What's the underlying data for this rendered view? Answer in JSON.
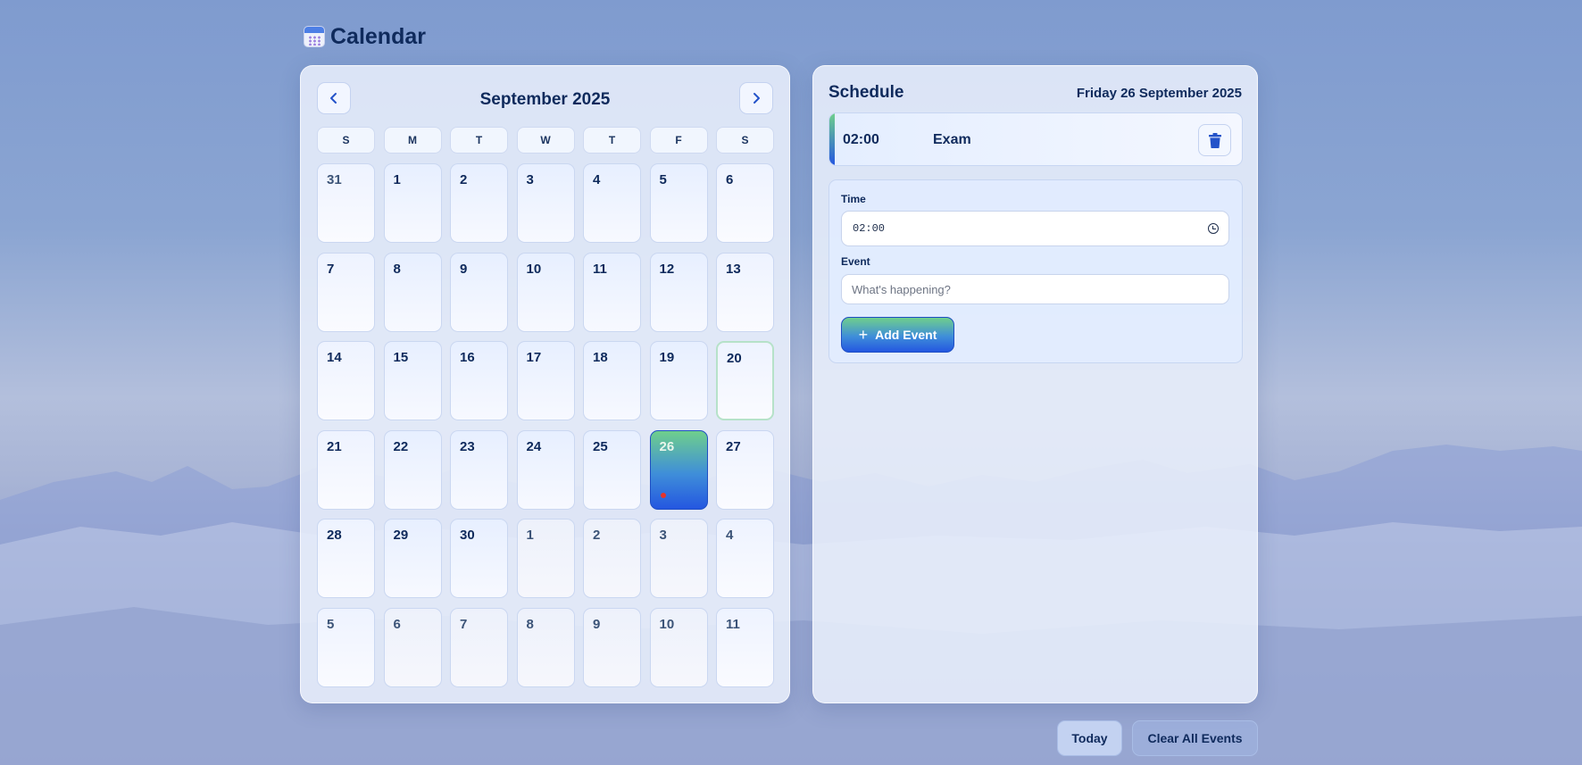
{
  "app": {
    "title": "Calendar",
    "icon": "calendar-icon"
  },
  "calendar": {
    "month_label": "September 2025",
    "prev_icon": "chevron-left-icon",
    "next_icon": "chevron-right-icon",
    "weekdays": [
      "S",
      "M",
      "T",
      "W",
      "T",
      "F",
      "S"
    ],
    "days": [
      {
        "label": "31",
        "current": false
      },
      {
        "label": "1",
        "current": true
      },
      {
        "label": "2",
        "current": true
      },
      {
        "label": "3",
        "current": true
      },
      {
        "label": "4",
        "current": true
      },
      {
        "label": "5",
        "current": true
      },
      {
        "label": "6",
        "current": true
      },
      {
        "label": "7",
        "current": true
      },
      {
        "label": "8",
        "current": true
      },
      {
        "label": "9",
        "current": true
      },
      {
        "label": "10",
        "current": true
      },
      {
        "label": "11",
        "current": true
      },
      {
        "label": "12",
        "current": true
      },
      {
        "label": "13",
        "current": true
      },
      {
        "label": "14",
        "current": true
      },
      {
        "label": "15",
        "current": true
      },
      {
        "label": "16",
        "current": true
      },
      {
        "label": "17",
        "current": true
      },
      {
        "label": "18",
        "current": true
      },
      {
        "label": "19",
        "current": true
      },
      {
        "label": "20",
        "current": true,
        "today": true
      },
      {
        "label": "21",
        "current": true
      },
      {
        "label": "22",
        "current": true
      },
      {
        "label": "23",
        "current": true
      },
      {
        "label": "24",
        "current": true
      },
      {
        "label": "25",
        "current": true
      },
      {
        "label": "26",
        "current": true,
        "selected": true,
        "has_event": true
      },
      {
        "label": "27",
        "current": true
      },
      {
        "label": "28",
        "current": true
      },
      {
        "label": "29",
        "current": true
      },
      {
        "label": "30",
        "current": true
      },
      {
        "label": "1",
        "current": false
      },
      {
        "label": "2",
        "current": false
      },
      {
        "label": "3",
        "current": false
      },
      {
        "label": "4",
        "current": false
      },
      {
        "label": "5",
        "current": false
      },
      {
        "label": "6",
        "current": false
      },
      {
        "label": "7",
        "current": false
      },
      {
        "label": "8",
        "current": false
      },
      {
        "label": "9",
        "current": false
      },
      {
        "label": "10",
        "current": false
      },
      {
        "label": "11",
        "current": false
      }
    ],
    "colors": {
      "selected_start": "#6fcf8c",
      "selected_end": "#2457e0",
      "event_dot": "#e5342b",
      "today_border": "#b6e2c9"
    }
  },
  "schedule": {
    "title": "Schedule",
    "date_label": "Friday 26 September 2025",
    "events": [
      {
        "time": "02:00",
        "name": "Exam",
        "delete_icon": "trash-icon"
      }
    ]
  },
  "form": {
    "time_label": "Time",
    "time_value": "02:00",
    "time_icon": "clock-icon",
    "event_label": "Event",
    "event_value": "",
    "event_placeholder": "What's happening?",
    "add_label": "Add Event",
    "add_icon": "plus-icon"
  },
  "footer": {
    "today_label": "Today",
    "clear_label": "Clear All Events"
  }
}
